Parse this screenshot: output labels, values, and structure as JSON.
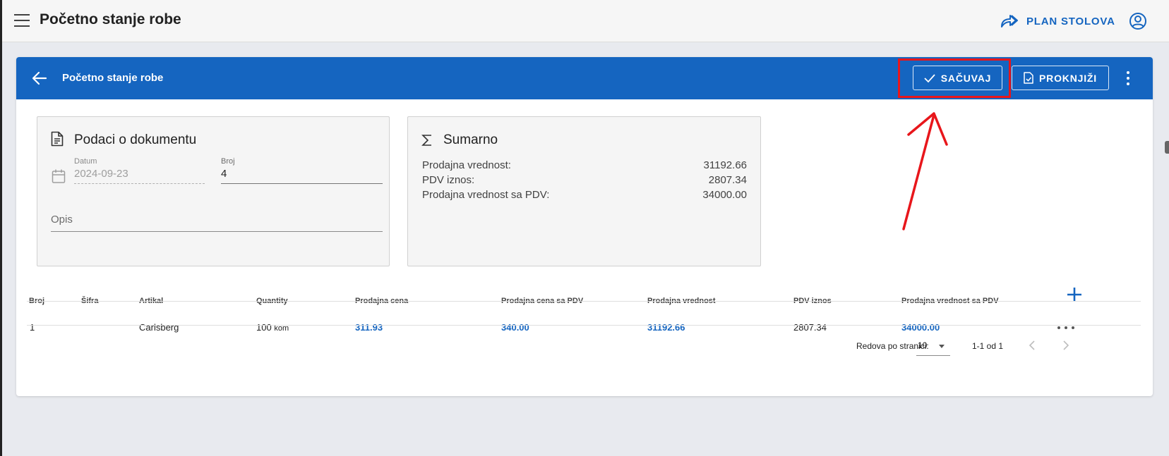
{
  "app": {
    "title": "Početno stanje robe",
    "plan_link": "PLAN STOLOVA"
  },
  "header": {
    "title": "Početno stanje robe",
    "save_label": "SAČUVAJ",
    "post_label": "PROKNJIŽI"
  },
  "document_panel": {
    "title": "Podaci o dokumentu",
    "date_label": "Datum",
    "date_value": "2024-09-23",
    "number_label": "Broj",
    "number_value": "4",
    "description_label": "Opis"
  },
  "summary_panel": {
    "title": "Sumarno",
    "rows": [
      {
        "label": "Prodajna vrednost:",
        "value": "31192.66"
      },
      {
        "label": "PDV iznos:",
        "value": "2807.34"
      },
      {
        "label": "Prodajna vrednost sa PDV:",
        "value": "34000.00"
      }
    ]
  },
  "table": {
    "columns": [
      "Broj",
      "Šifra",
      "Artikal",
      "Quantity",
      "Prodajna cena",
      "Prodajna cena sa PDV",
      "Prodajna vrednost",
      "PDV iznos",
      "Prodajna vrednost sa PDV"
    ],
    "rows": [
      {
        "broj": "1",
        "sifra": "",
        "artikal": "Carlsberg",
        "quantity": "100",
        "unit": "kom",
        "prodajna_cena": "311.93",
        "prodajna_cena_pdv": "340.00",
        "prodajna_vrednost": "31192.66",
        "pdv_iznos": "2807.34",
        "prodajna_vrednost_pdv": "34000.00"
      }
    ]
  },
  "pagination": {
    "rows_per_page_label": "Redova po stranici:",
    "rows_per_page_value": "10",
    "range_label": "1-1 od 1"
  },
  "colors": {
    "primary": "#1565c0",
    "annotation": "#e8161b"
  },
  "icons": [
    "menu-icon",
    "share-forward-icon",
    "account-circle-icon",
    "arrow-left-icon",
    "check-icon",
    "document-check-icon",
    "more-vertical-icon",
    "document-icon",
    "calendar-icon",
    "sigma-icon",
    "plus-icon",
    "more-horizontal-icon",
    "chevron-left-icon",
    "chevron-right-icon"
  ]
}
